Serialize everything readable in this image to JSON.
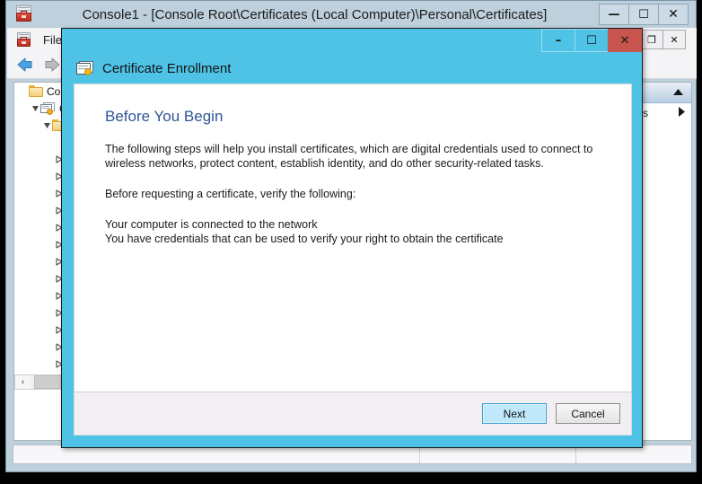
{
  "main_window": {
    "title": "Console1 - [Console Root\\Certificates (Local Computer)\\Personal\\Certificates]",
    "app_icon": "mmc-console-icon",
    "controls": {
      "minimize": "—",
      "maximize": "☐",
      "close": "✕"
    },
    "menubar": {
      "icon": "mmc-console-icon",
      "items": [
        "File"
      ]
    },
    "toolbar": {
      "back": "back-arrow-icon",
      "forward": "forward-arrow-icon"
    },
    "mdi_controls": {
      "minimize": "–",
      "restore": "❐",
      "close": "✕"
    }
  },
  "tree": {
    "rows": [
      {
        "indent": 0,
        "twisty": "none",
        "icon": "folder",
        "label": "Cons"
      },
      {
        "indent": 1,
        "twisty": "expanded",
        "icon": "certstore",
        "label": "C"
      },
      {
        "indent": 2,
        "twisty": "expanded",
        "icon": "folder",
        "label": ""
      },
      {
        "indent": 3,
        "twisty": "none",
        "icon": "none",
        "label": ""
      },
      {
        "indent": 3,
        "twisty": "collapsed",
        "icon": "folder",
        "label": ""
      },
      {
        "indent": 3,
        "twisty": "collapsed",
        "icon": "folder",
        "label": ""
      },
      {
        "indent": 3,
        "twisty": "collapsed",
        "icon": "folder",
        "label": ""
      },
      {
        "indent": 3,
        "twisty": "collapsed",
        "icon": "folder",
        "label": ""
      },
      {
        "indent": 3,
        "twisty": "collapsed",
        "icon": "folder",
        "label": ""
      },
      {
        "indent": 3,
        "twisty": "collapsed",
        "icon": "folder",
        "label": ""
      },
      {
        "indent": 3,
        "twisty": "collapsed",
        "icon": "folder",
        "label": ""
      },
      {
        "indent": 3,
        "twisty": "collapsed",
        "icon": "folder",
        "label": ""
      },
      {
        "indent": 3,
        "twisty": "collapsed",
        "icon": "folder",
        "label": ""
      },
      {
        "indent": 3,
        "twisty": "collapsed",
        "icon": "folder",
        "label": ""
      },
      {
        "indent": 3,
        "twisty": "collapsed",
        "icon": "folder",
        "label": ""
      },
      {
        "indent": 3,
        "twisty": "collapsed",
        "icon": "folder",
        "label": ""
      },
      {
        "indent": 3,
        "twisty": "collapsed",
        "icon": "folder",
        "label": ""
      }
    ],
    "scrollbar": {
      "left_arrow": "‹",
      "grip": "‖"
    }
  },
  "actions_pane": {
    "collapse_icon": "triangle-up-icon",
    "row_label": "s",
    "submenu_icon": "triangle-right-icon"
  },
  "statusbar": {
    "panes": [
      "",
      "",
      ""
    ]
  },
  "dialog": {
    "title": "Certificate Enrollment",
    "icon": "certificate-icon",
    "controls": {
      "minimize": "–",
      "maximize": "☐",
      "close": "✕"
    },
    "heading": "Before You Begin",
    "paragraphs": [
      "The following steps will help you install certificates, which are digital credentials used to connect to wireless networks, protect content, establish identity, and do other security-related tasks.",
      "Before requesting a certificate, verify the following:"
    ],
    "checklist": [
      "Your computer is connected to the network",
      "You have credentials that can be used to verify your right to obtain the certificate"
    ],
    "buttons": {
      "next": "Next",
      "cancel": "Cancel"
    }
  },
  "colors": {
    "dialog_accent": "#4ec3e6",
    "close_red": "#c8544f",
    "heading_blue": "#2f5496",
    "window_chrome": "#bdd0dc",
    "primary_button": "#bfe8fb"
  }
}
